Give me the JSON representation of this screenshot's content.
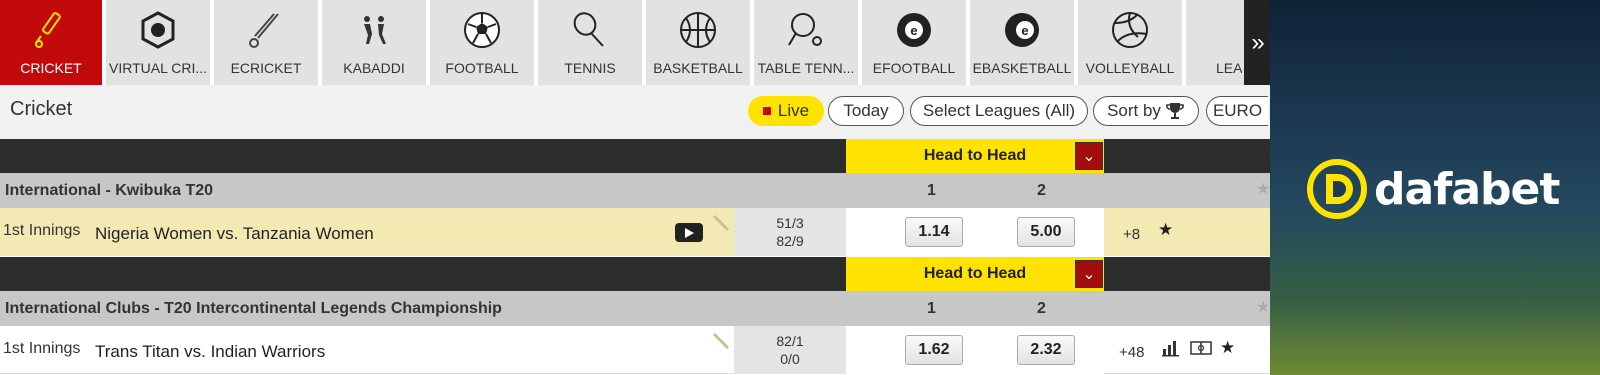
{
  "sports_nav": {
    "items": [
      {
        "label": "CRICKET",
        "icon": "cricket-icon",
        "active": true
      },
      {
        "label": "VIRTUAL CRI...",
        "icon": "virtual-cricket-icon",
        "active": false
      },
      {
        "label": "ECRICKET",
        "icon": "ecricket-icon",
        "active": false
      },
      {
        "label": "KABADDI",
        "icon": "kabaddi-icon",
        "active": false
      },
      {
        "label": "FOOTBALL",
        "icon": "football-icon",
        "active": false
      },
      {
        "label": "TENNIS",
        "icon": "tennis-icon",
        "active": false
      },
      {
        "label": "BASKETBALL",
        "icon": "basketball-icon",
        "active": false
      },
      {
        "label": "TABLE TENN...",
        "icon": "table-tennis-icon",
        "active": false
      },
      {
        "label": "EFOOTBALL",
        "icon": "efootball-icon",
        "active": false
      },
      {
        "label": "EBASKETBALL",
        "icon": "ebasketball-icon",
        "active": false
      },
      {
        "label": "VOLLEYBALL",
        "icon": "volleyball-icon",
        "active": false
      },
      {
        "label": "LEAG",
        "icon": "league-icon",
        "active": false
      }
    ],
    "more_glyph": "»"
  },
  "filters": {
    "title": "Cricket",
    "live_label": "Live",
    "today_label": "Today",
    "leagues_label": "Select Leagues (All)",
    "sort_label": "Sort by",
    "odds_format_label": "EURO"
  },
  "market": {
    "label": "Head to Head",
    "toggle_glyph": "⌄"
  },
  "leagues": [
    {
      "name": "International - Kwibuka T20",
      "col1": "1",
      "col2": "2",
      "match": {
        "innings": "1st Innings",
        "teams": "Nigeria Women vs. Tanzania Women",
        "score_home": "51/3",
        "score_away": "82/9",
        "odd1": "1.14",
        "odd2": "5.00",
        "more_markets": "+8"
      }
    },
    {
      "name": "International Clubs - T20 Intercontinental Legends Championship",
      "col1": "1",
      "col2": "2",
      "match": {
        "innings": "1st Innings",
        "teams": "Trans Titan vs. Indian Warriors",
        "score_home": "82/1",
        "score_away": "0/0",
        "odd1": "1.62",
        "odd2": "2.32",
        "more_markets": "+48"
      }
    }
  ],
  "brand": {
    "name": "dafabet",
    "accent": "#ffe300",
    "active_tab_color": "#c20a0a"
  }
}
